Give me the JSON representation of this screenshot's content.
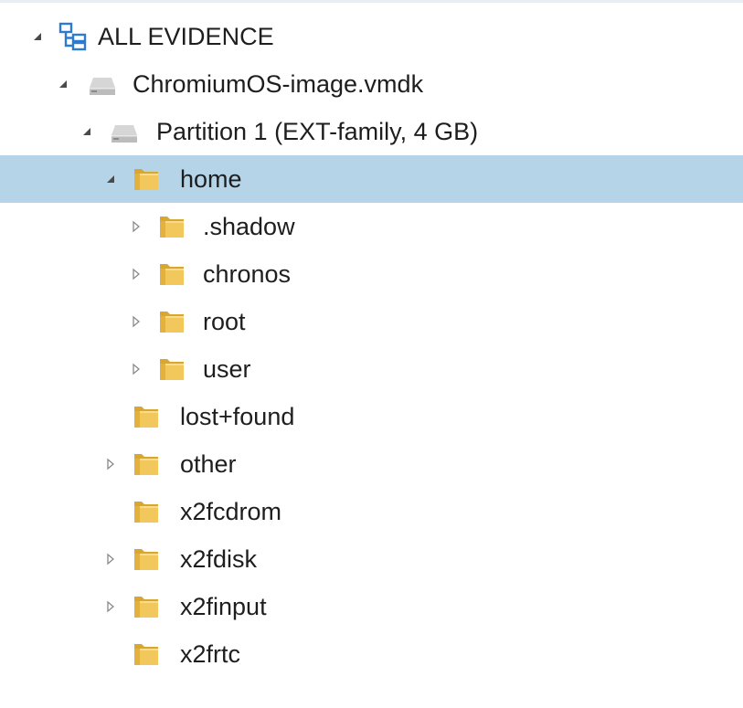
{
  "colors": {
    "selection": "#b5d4e8",
    "folder": "#f2c75c",
    "folder_dark": "#d9a730",
    "drive": "#bcbcbc",
    "evidence": "#2b7bd1",
    "expander": "#7a7a7a"
  },
  "tree": {
    "root": {
      "label": "ALL EVIDENCE",
      "icon": "evidence-tree-icon",
      "expanded": true
    },
    "image": {
      "label": "ChromiumOS-image.vmdk",
      "icon": "disk-image-icon",
      "expanded": true
    },
    "partition": {
      "label": "Partition 1 (EXT-family, 4 GB)",
      "icon": "partition-drive-icon",
      "expanded": true
    },
    "home": {
      "label": "home",
      "icon": "folder-icon",
      "expanded": true,
      "selected": true
    },
    "home_children": [
      {
        "label": ".shadow",
        "icon": "folder-icon",
        "expandable": true
      },
      {
        "label": "chronos",
        "icon": "folder-icon",
        "expandable": true
      },
      {
        "label": "root",
        "icon": "folder-icon",
        "expandable": true
      },
      {
        "label": "user",
        "icon": "folder-icon",
        "expandable": true
      }
    ],
    "partition_folders": [
      {
        "label": "lost+found",
        "icon": "folder-icon",
        "expandable": false
      },
      {
        "label": "other",
        "icon": "folder-icon",
        "expandable": true
      },
      {
        "label": "x2fcdrom",
        "icon": "folder-icon",
        "expandable": false
      },
      {
        "label": "x2fdisk",
        "icon": "folder-icon",
        "expandable": true
      },
      {
        "label": "x2finput",
        "icon": "folder-icon",
        "expandable": true
      },
      {
        "label": "x2frtc",
        "icon": "folder-icon",
        "expandable": false
      }
    ]
  }
}
